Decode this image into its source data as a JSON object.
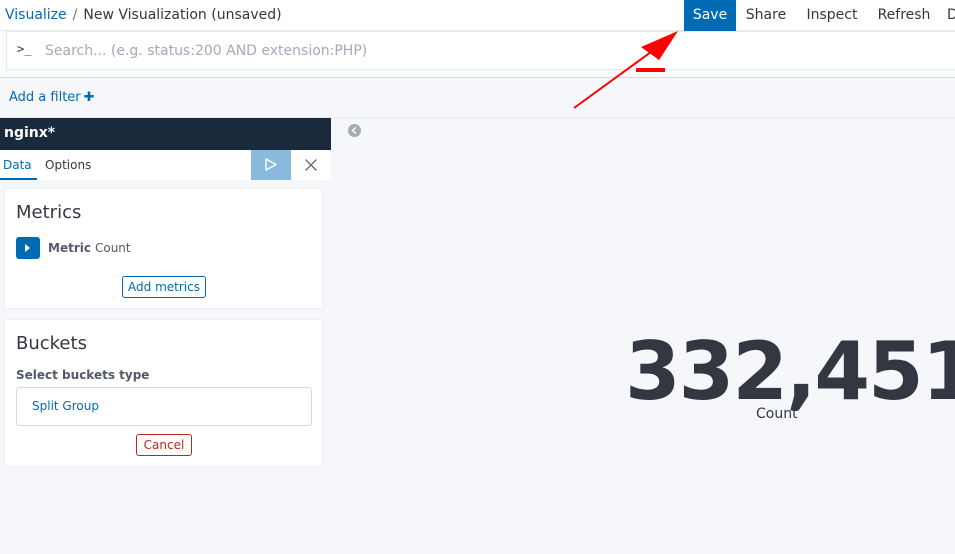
{
  "breadcrumb": {
    "parent": "Visualize",
    "separator": "/",
    "current": "New Visualization (unsaved)"
  },
  "top_actions": {
    "save": "Save",
    "share": "Share",
    "inspect": "Inspect",
    "refresh": "Refresh",
    "clipped": "D"
  },
  "query_bar": {
    "prompt_icon": ">_",
    "placeholder": "Search... (e.g. status:200 AND extension:PHP)"
  },
  "filter_bar": {
    "add_filter": "Add a filter",
    "add_icon": "plus-icon"
  },
  "editor": {
    "index_pattern": "nginx*",
    "tabs": [
      "Data",
      "Options"
    ],
    "active_tab": "Data",
    "apply_icon": "play-icon",
    "discard_icon": "close-icon",
    "metrics": {
      "title": "Metrics",
      "metric_label": "Metric",
      "metric_value": "Count",
      "toggle_icon": "caret-right-icon",
      "add_button": "Add metrics"
    },
    "buckets": {
      "title": "Buckets",
      "select_label": "Select buckets type",
      "select_option": "Split Group",
      "cancel_button": "Cancel"
    }
  },
  "visualization": {
    "collapse_icon": "chevron-left-circle-icon",
    "resize_icon": "vertical-dots-icon",
    "value": "332,451",
    "label": "Count"
  },
  "colors": {
    "primary": "#006bb4",
    "header_dark": "#1a2a3d",
    "apply_disabled": "#8ab9de",
    "danger": "#bd271e",
    "annotation_red": "#ff0000"
  },
  "annotation": {
    "type": "red-arrow-pointing-to-save",
    "icon": "red-arrow-icon"
  }
}
